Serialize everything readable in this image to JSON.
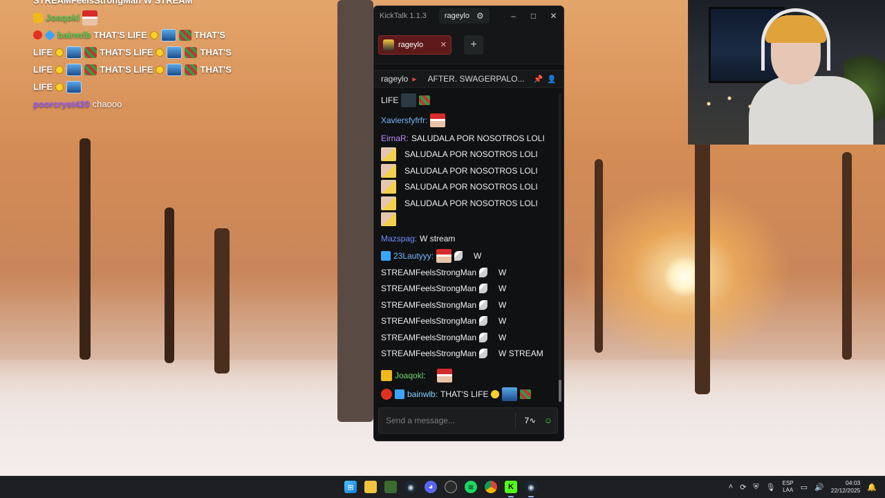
{
  "overlay": {
    "lines": [
      {
        "user": "",
        "text": "STREAMFeelsStrongMan  W STREAM"
      },
      {
        "user": "Joaqokl",
        "text": ""
      },
      {
        "user": "bainwlb",
        "text": "THAT'S LIFE"
      },
      {
        "text_a": "LIFE",
        "text_b": "THAT'S LIFE",
        "text_c": "THAT'S"
      },
      {
        "text_a": "LIFE",
        "text_b": "THAT'S LIFE",
        "text_c": "THAT'S"
      },
      {
        "text_a": "LIFE"
      },
      {
        "user": "poorcryst420",
        "text": "chaooo"
      }
    ],
    "trailing_thats": "THAT'S"
  },
  "window": {
    "app_title": "KickTalk 1.1.3",
    "user_chip": "rageylo",
    "controls": {
      "minimize": "–",
      "maximize": "□",
      "close": "✕"
    }
  },
  "tabs": [
    {
      "label": "rageylo",
      "close": "✕"
    }
  ],
  "add_tab": "+",
  "stream": {
    "channel": "rageylo",
    "title": "AFTER. SWAGERPALO..."
  },
  "messages": {
    "top_partial": "LIFE",
    "m1_user": "Xaviersfyfrfr:",
    "m2_user": "EirnaR:",
    "m2_text": "SALUDALA POR NOSOTROS LOLI",
    "m2_repeat": "SALUDALA POR NOSOTROS LOLI",
    "m3_user": "Mazspag:",
    "m3_text": "W stream",
    "m4_user": "23Lautyyy:",
    "m4_first": "W",
    "m4_word": "STREAMFeelsStrongMan",
    "m4_w": "W",
    "m4_last": "W STREAM",
    "m5_user": "Joaqokl:",
    "m6_user": "bainwlb:",
    "m6_text": "THAT'S LIFE"
  },
  "input": {
    "placeholder": "Send a message..."
  },
  "taskbar": {
    "lang_top": "ESP",
    "lang_bottom": "LAA",
    "time": "04:03",
    "date": "22/12/2025"
  }
}
